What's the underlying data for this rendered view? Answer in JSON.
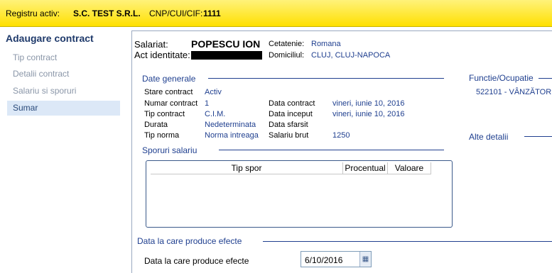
{
  "topbar": {
    "registry_label": "Registru activ:",
    "company": "S.C. TEST S.R.L.",
    "cnp_label": "CNP/CUI/CIF:",
    "cnp_value": "1111"
  },
  "sidebar": {
    "title": "Adaugare contract",
    "items": [
      {
        "label": "Tip contract"
      },
      {
        "label": "Detalii contract"
      },
      {
        "label": "Salariu si sporuri"
      },
      {
        "label": "Sumar"
      }
    ]
  },
  "employee": {
    "salariat_label": "Salariat:",
    "name": "POPESCU ION",
    "cetatenie_label": "Cetatenie:",
    "cetatenie": "Romana",
    "act_label": "Act identitate:",
    "domiciliu_label": "Domiciliul:",
    "domiciliu": "CLUJ, CLUJ-NAPOCA"
  },
  "general": {
    "title": "Date generale",
    "stare_label": "Stare contract",
    "stare": "Activ",
    "numar_label": "Numar contract",
    "numar": "1",
    "tip_label": "Tip contract",
    "tip": "C.I.M.",
    "durata_label": "Durata",
    "durata": "Nedeterminata",
    "norma_label": "Tip norma",
    "norma": "Norma intreaga",
    "data_contract_label": "Data contract",
    "data_contract": "vineri, iunie 10, 2016",
    "data_inceput_label": "Data inceput",
    "data_inceput": "vineri, iunie 10, 2016",
    "data_sfarsit_label": "Data sfarsit",
    "salariu_label": "Salariu brut",
    "salariu": "1250"
  },
  "functie": {
    "title": "Functie/Ocupatie",
    "value": "522101 - VÂNZĂTOR"
  },
  "alte": {
    "title": "Alte detalii"
  },
  "sporuri": {
    "title": "Sporuri salariu",
    "columns": [
      "Tip spor",
      "Procentual",
      "Valoare"
    ]
  },
  "efecte": {
    "title": "Data la care produce efecte",
    "field_label": "Data la care produce efecte",
    "date_value": "6/10/2016"
  }
}
